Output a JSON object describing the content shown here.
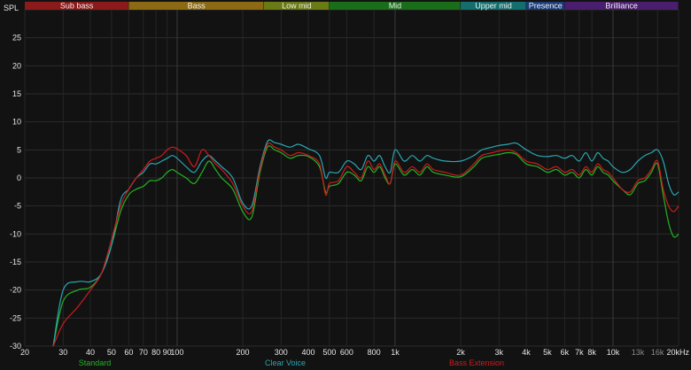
{
  "chart_data": {
    "type": "line",
    "ylabel": "SPL",
    "ylim": [
      -30,
      30
    ],
    "xlim": [
      20,
      20000
    ],
    "x_scale": "log",
    "grid": true,
    "yticks": [
      "25",
      "20",
      "15",
      "10",
      "5",
      "0",
      "-5",
      "-10",
      "-15",
      "-20",
      "-25",
      "-30"
    ],
    "ytick_values": [
      25,
      20,
      15,
      10,
      5,
      0,
      -5,
      -10,
      -15,
      -20,
      -25,
      -30
    ],
    "xticks": [
      {
        "label": "20",
        "value": 20
      },
      {
        "label": "30",
        "value": 30
      },
      {
        "label": "40",
        "value": 40
      },
      {
        "label": "50",
        "value": 50
      },
      {
        "label": "60",
        "value": 60
      },
      {
        "label": "70",
        "value": 70
      },
      {
        "label": "80",
        "value": 80
      },
      {
        "label": "90",
        "value": 90
      },
      {
        "label": "100",
        "value": 100
      },
      {
        "label": "200",
        "value": 200
      },
      {
        "label": "300",
        "value": 300
      },
      {
        "label": "400",
        "value": 400
      },
      {
        "label": "500",
        "value": 500
      },
      {
        "label": "600",
        "value": 600
      },
      {
        "label": "800",
        "value": 800
      },
      {
        "label": "1k",
        "value": 1000
      },
      {
        "label": "2k",
        "value": 2000
      },
      {
        "label": "3k",
        "value": 3000
      },
      {
        "label": "4k",
        "value": 4000
      },
      {
        "label": "5k",
        "value": 5000
      },
      {
        "label": "6k",
        "value": 6000
      },
      {
        "label": "7k",
        "value": 7000
      },
      {
        "label": "8k",
        "value": 8000
      },
      {
        "label": "10k",
        "value": 10000
      },
      {
        "label": "13k",
        "value": 13000,
        "dim": true
      },
      {
        "label": "16k",
        "value": 16000,
        "dim": true
      },
      {
        "label": "20kHz",
        "value": 20000
      }
    ],
    "bands": [
      {
        "label": "Sub bass",
        "from": 20,
        "to": 60,
        "color": "#8c1a1a"
      },
      {
        "label": "Bass",
        "from": 60,
        "to": 250,
        "color": "#8c6a14"
      },
      {
        "label": "Low mid",
        "from": 250,
        "to": 500,
        "color": "#6a7a14"
      },
      {
        "label": "Mid",
        "from": 500,
        "to": 2000,
        "color": "#1a6e1a"
      },
      {
        "label": "Upper mid",
        "from": 2000,
        "to": 4000,
        "color": "#146e6e"
      },
      {
        "label": "Presence",
        "from": 4000,
        "to": 6000,
        "color": "#1a3c78"
      },
      {
        "label": "Brilliance",
        "from": 6000,
        "to": 20000,
        "color": "#4a1e6e"
      }
    ],
    "series": [
      {
        "name": "Standard",
        "color": "#22b422",
        "x": [
          27,
          30,
          35,
          40,
          45,
          50,
          55,
          60,
          65,
          70,
          75,
          80,
          85,
          90,
          95,
          100,
          110,
          120,
          130,
          140,
          150,
          160,
          180,
          200,
          220,
          240,
          260,
          280,
          300,
          330,
          360,
          400,
          450,
          480,
          500,
          550,
          600,
          650,
          700,
          750,
          800,
          850,
          900,
          950,
          1000,
          1100,
          1200,
          1300,
          1400,
          1500,
          1700,
          2000,
          2300,
          2500,
          2800,
          3000,
          3300,
          3600,
          4000,
          4500,
          5000,
          5500,
          6000,
          6500,
          7000,
          7500,
          8000,
          8500,
          9000,
          9500,
          10000,
          11000,
          12000,
          13000,
          14000,
          15000,
          16000,
          17000,
          18000,
          19000,
          20000
        ],
        "y": [
          -30,
          -22,
          -20,
          -19.5,
          -17,
          -12,
          -6,
          -3,
          -2,
          -1.5,
          -0.5,
          -0.5,
          0,
          1,
          1.5,
          1,
          0,
          -1,
          1,
          3,
          1.5,
          0,
          -2,
          -6,
          -7,
          1,
          5.5,
          5,
          4.5,
          3.5,
          4,
          3.8,
          2,
          -2.5,
          -1.5,
          -1,
          1,
          0.5,
          -0.5,
          2,
          1,
          2,
          0,
          -1,
          2.5,
          0.5,
          1.5,
          0.5,
          2,
          1,
          0.5,
          0.2,
          2,
          3.5,
          4,
          4.2,
          4.5,
          4.2,
          2.5,
          2,
          1,
          1.5,
          0.5,
          1,
          0,
          1.5,
          0.5,
          2,
          1,
          0.5,
          -0.5,
          -2,
          -3,
          -1,
          -0.5,
          1,
          2.5,
          -3,
          -8,
          -10.5,
          -10
        ]
      },
      {
        "name": "Clear Voice",
        "color": "#2aa6b2",
        "x": [
          27,
          30,
          35,
          40,
          45,
          50,
          55,
          60,
          65,
          70,
          75,
          80,
          85,
          90,
          95,
          100,
          110,
          120,
          130,
          140,
          150,
          160,
          180,
          200,
          220,
          240,
          260,
          280,
          300,
          330,
          360,
          400,
          450,
          480,
          500,
          550,
          600,
          650,
          700,
          750,
          800,
          850,
          900,
          950,
          1000,
          1100,
          1200,
          1300,
          1400,
          1500,
          1700,
          2000,
          2300,
          2500,
          2800,
          3000,
          3300,
          3600,
          4000,
          4500,
          5000,
          5500,
          6000,
          6500,
          7000,
          7500,
          8000,
          8500,
          9000,
          9500,
          10000,
          11000,
          12000,
          13000,
          14000,
          15000,
          16000,
          17000,
          18000,
          19000,
          20000
        ],
        "y": [
          -30,
          -20,
          -18.5,
          -18.5,
          -17,
          -12,
          -4,
          -2,
          0,
          1,
          2.5,
          2.5,
          3,
          3.5,
          4,
          3.5,
          2,
          1,
          3,
          4,
          3,
          2,
          0,
          -4.5,
          -5,
          2,
          6.5,
          6.3,
          6,
          5.5,
          6,
          5.2,
          4,
          0,
          1,
          1,
          3,
          2.5,
          1.5,
          4,
          3,
          4,
          2,
          1,
          5,
          3,
          4,
          3,
          4,
          3.5,
          3,
          3,
          4,
          5,
          5.5,
          5.8,
          6,
          6.2,
          5,
          4,
          3.8,
          4,
          3.5,
          4,
          3,
          4.5,
          3,
          4.5,
          3.5,
          3,
          2,
          1,
          1.5,
          3,
          4,
          4.5,
          5,
          3,
          -1,
          -3,
          -2.5
        ]
      },
      {
        "name": "Bass Extension",
        "color": "#d01c1c",
        "x": [
          27,
          30,
          35,
          40,
          45,
          50,
          55,
          60,
          65,
          70,
          75,
          80,
          85,
          90,
          95,
          100,
          110,
          120,
          130,
          140,
          150,
          160,
          180,
          200,
          220,
          240,
          260,
          280,
          300,
          330,
          360,
          400,
          450,
          480,
          500,
          550,
          600,
          650,
          700,
          750,
          800,
          850,
          900,
          950,
          1000,
          1100,
          1200,
          1300,
          1400,
          1500,
          1700,
          2000,
          2300,
          2500,
          2800,
          3000,
          3300,
          3600,
          4000,
          4500,
          5000,
          5500,
          6000,
          6500,
          7000,
          7500,
          8000,
          8500,
          9000,
          9500,
          10000,
          11000,
          12000,
          13000,
          14000,
          15000,
          16000,
          17000,
          18000,
          19000,
          20000
        ],
        "y": [
          -30,
          -26,
          -23,
          -20,
          -17,
          -11,
          -5,
          -2,
          0,
          1.5,
          3,
          3.5,
          4,
          5,
          5.5,
          5.2,
          4,
          2,
          5,
          4,
          2.5,
          1.5,
          -1,
          -5,
          -6,
          1.5,
          6,
          5.5,
          5,
          4,
          4.5,
          4,
          2.5,
          -3,
          -1,
          -0.5,
          2,
          1,
          0,
          3,
          1.5,
          2.5,
          0.5,
          -1,
          3,
          1,
          2,
          1,
          2.5,
          1.5,
          1,
          0.5,
          2.5,
          4,
          4.5,
          4.8,
          5,
          4.5,
          3,
          2.5,
          1.5,
          2,
          1,
          1.5,
          0.5,
          2,
          1,
          2.5,
          1.5,
          1,
          0,
          -2,
          -2.5,
          -0.5,
          0,
          1.5,
          3,
          -2,
          -5,
          -6,
          -5
        ]
      }
    ]
  }
}
